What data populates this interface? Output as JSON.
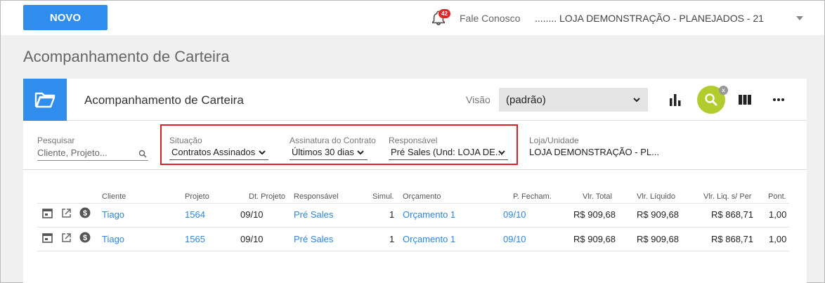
{
  "topbar": {
    "novo_label": "NOVO",
    "notification_count": "42",
    "fale_conosco": "Fale Conosco",
    "store": "........ LOJA DEMONSTRAÇÃO - PLANEJADOS - 21"
  },
  "page_title": "Acompanhamento de Carteira",
  "card": {
    "title": "Acompanhamento de Carteira",
    "visao_label": "Visão",
    "visao_value": "(padrão)",
    "search_clear": "x"
  },
  "filters": {
    "pesquisar": {
      "label": "Pesquisar",
      "placeholder": "Cliente, Projeto..."
    },
    "situacao": {
      "label": "Situação",
      "value": "Contratos Assinados"
    },
    "assinatura": {
      "label": "Assinatura do Contrato",
      "value": "Últimos 30 dias"
    },
    "responsavel": {
      "label": "Responsável",
      "value": "Pré Sales (Und: LOJA DE..."
    },
    "loja": {
      "label": "Loja/Unidade",
      "value": "LOJA DEMONSTRAÇÃO - PL..."
    }
  },
  "table": {
    "headers": {
      "cliente": "Cliente",
      "projeto": "Projeto",
      "dt_projeto": "Dt. Projeto",
      "responsavel": "Responsável",
      "simul": "Simul.",
      "orcamento": "Orçamento",
      "p_fecham": "P. Fecham.",
      "vlr_total": "Vlr. Total",
      "vlr_liquido": "Vlr. Líquido",
      "vlr_liq_per": "Vlr. Liq. s/ Per",
      "pont": "Pont."
    },
    "rows": [
      {
        "cliente": "Tiago",
        "projeto": "1564",
        "dt_projeto": "09/10",
        "responsavel": "Pré Sales",
        "simul": "1",
        "orcamento": "Orçamento 1",
        "p_fecham": "09/10",
        "vlr_total": "R$ 909,68",
        "vlr_liquido": "R$ 909,68",
        "vlr_liq_per": "R$ 868,71",
        "pont": "1,00"
      },
      {
        "cliente": "Tiago",
        "projeto": "1565",
        "dt_projeto": "09/10",
        "responsavel": "Pré Sales",
        "simul": "1",
        "orcamento": "Orçamento 1",
        "p_fecham": "09/10",
        "vlr_total": "R$ 909,68",
        "vlr_liquido": "R$ 909,68",
        "vlr_liq_per": "R$ 868,71",
        "pont": "1,00"
      }
    ]
  },
  "colors": {
    "primary": "#2f8eed",
    "search_accent": "#b2cc2e",
    "link": "#2e86de",
    "highlight_border": "#d82227",
    "badge": "#e0282b"
  }
}
